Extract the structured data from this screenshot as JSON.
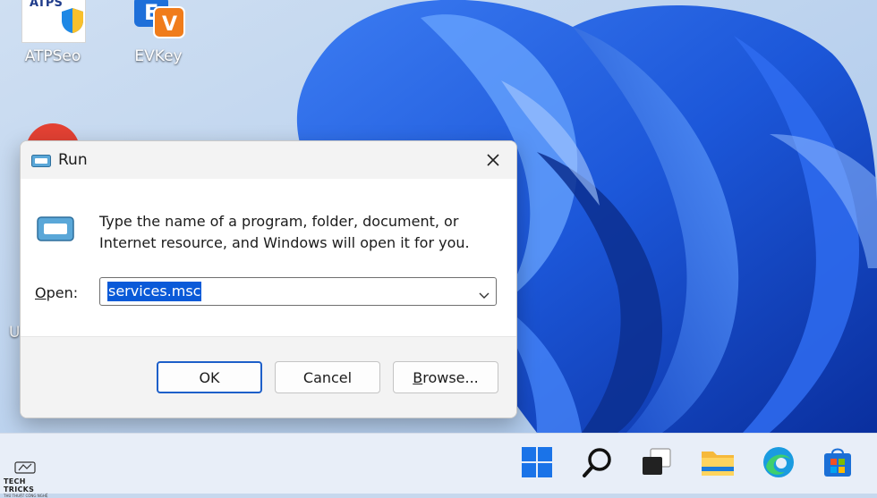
{
  "desktop": {
    "icons": [
      {
        "label": "ATPSeo",
        "logo_text": "ATPS"
      },
      {
        "label": "EVKey"
      }
    ],
    "partial_label": "U"
  },
  "run_dialog": {
    "title": "Run",
    "description": "Type the name of a program, folder, document, or Internet resource, and Windows will open it for you.",
    "open_label_mnemonic": "O",
    "open_label_rest": "pen:",
    "open_value": "services.msc",
    "buttons": {
      "ok": "OK",
      "cancel": "Cancel",
      "browse_mnemonic": "B",
      "browse_rest": "rowse..."
    }
  },
  "watermark": {
    "title": "TECH TRICKS",
    "subtitle": "THỦ THUẬT CÔNG NGHỆ"
  },
  "colors": {
    "accent": "#0a5ad8",
    "dialog_footer": "#f3f3f3",
    "taskbar": "#e8eef8"
  },
  "taskbar": {
    "icons": [
      "start-icon",
      "search-icon",
      "task-view-icon",
      "file-explorer-icon",
      "edge-icon",
      "store-icon"
    ]
  }
}
